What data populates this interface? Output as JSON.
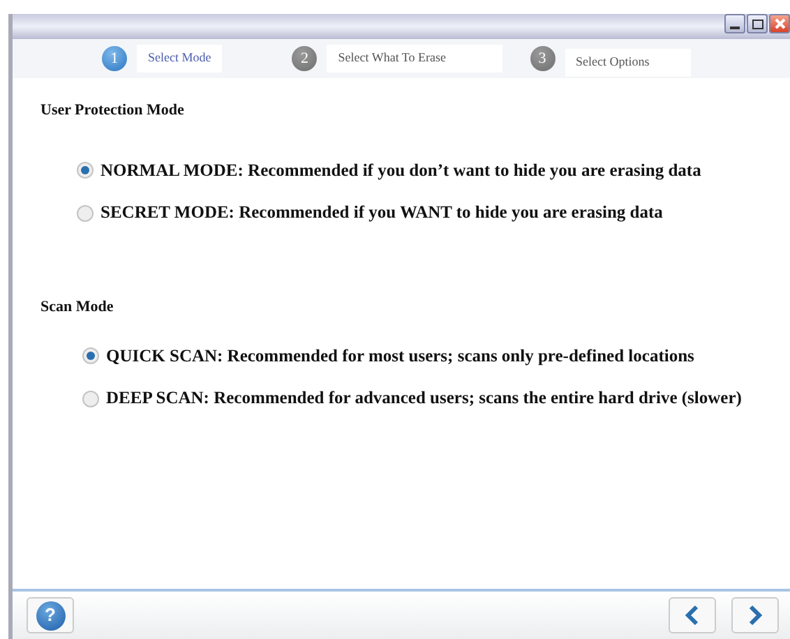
{
  "steps": [
    {
      "number": "1",
      "label": "Select Mode",
      "selected": true
    },
    {
      "number": "2",
      "label": "Select What To Erase",
      "selected": false
    },
    {
      "number": "3",
      "label": "Select Options",
      "selected": false
    }
  ],
  "sections": [
    {
      "title": "User Protection Mode",
      "options": [
        {
          "label": "NORMAL MODE: Recommended if you don’t want to hide you are erasing data",
          "selected": true
        },
        {
          "label": "SECRET MODE: Recommended if you WANT to hide you are erasing data",
          "selected": false
        }
      ]
    },
    {
      "title": "Scan Mode",
      "options": [
        {
          "label": "QUICK SCAN: Recommended for most users; scans only pre-defined locations",
          "selected": true
        },
        {
          "label": "DEEP SCAN: Recommended for advanced users; scans the entire hard drive (slower)",
          "selected": false
        }
      ]
    }
  ],
  "help_button": {
    "label": "?"
  }
}
